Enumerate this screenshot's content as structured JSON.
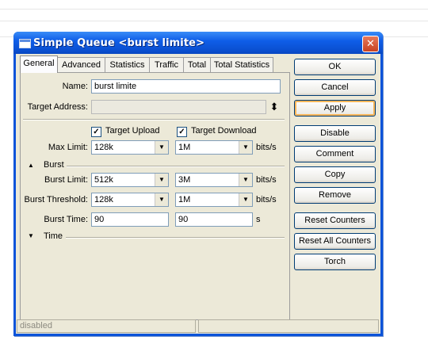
{
  "window": {
    "title": "Simple Queue <burst limite>",
    "close_glyph": "✕"
  },
  "tabs": [
    {
      "label": "General",
      "active": true
    },
    {
      "label": "Advanced"
    },
    {
      "label": "Statistics"
    },
    {
      "label": "Traffic"
    },
    {
      "label": "Total"
    },
    {
      "label": "Total Statistics"
    }
  ],
  "general": {
    "name_label": "Name:",
    "name_value": "burst limite",
    "target_address_label": "Target Address:",
    "target_address_value": "",
    "target_upload_label": "Target Upload",
    "target_upload_checked": true,
    "target_download_label": "Target Download",
    "target_download_checked": true,
    "max_limit_label": "Max Limit:",
    "max_limit_upload": "128k",
    "max_limit_download": "1M",
    "unit_bits": "bits/s",
    "burst_section": "Burst",
    "burst_limit_label": "Burst Limit:",
    "burst_limit_upload": "512k",
    "burst_limit_download": "3M",
    "burst_threshold_label": "Burst Threshold:",
    "burst_threshold_upload": "128k",
    "burst_threshold_download": "1M",
    "burst_time_label": "Burst Time:",
    "burst_time_upload": "90",
    "burst_time_download": "90",
    "unit_s": "s",
    "time_section": "Time"
  },
  "buttons": {
    "ok": "OK",
    "cancel": "Cancel",
    "apply": "Apply",
    "disable": "Disable",
    "comment": "Comment",
    "copy": "Copy",
    "remove": "Remove",
    "reset_counters": "Reset Counters",
    "reset_all_counters": "Reset All Counters",
    "torch": "Torch"
  },
  "status": {
    "left": "disabled",
    "right": ""
  },
  "icons": {
    "dropdown": "▼",
    "updown": "⬍",
    "collapse": "▲",
    "expand": "▼",
    "check": "✓"
  },
  "colors": {
    "titlebar": "#0a53d9",
    "face": "#ece9d8",
    "close": "#c84222"
  }
}
